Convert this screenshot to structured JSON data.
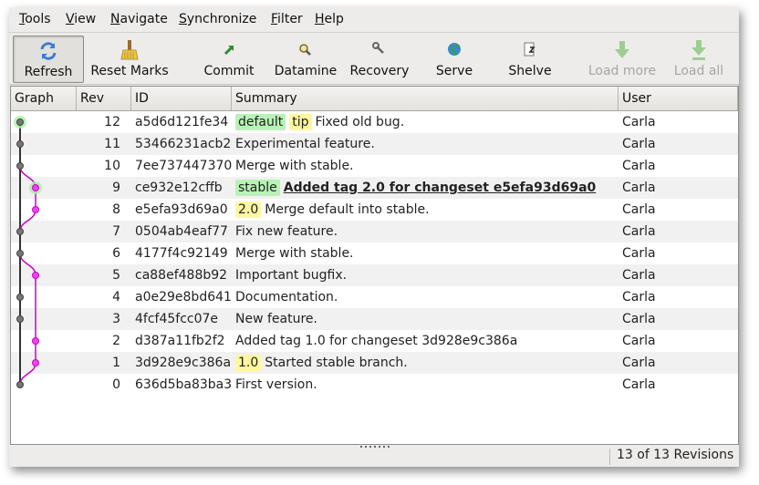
{
  "menu": [
    "Tools",
    "View",
    "Navigate",
    "Synchronize",
    "Filter",
    "Help"
  ],
  "menu_mnemonic": [
    "T",
    "V",
    "N",
    "S",
    "F",
    "H"
  ],
  "toolbar": {
    "refresh": "Refresh",
    "reset_marks": "Reset Marks",
    "commit": "Commit",
    "datamine": "Datamine",
    "recovery": "Recovery",
    "serve": "Serve",
    "shelve": "Shelve",
    "load_more": "Load more",
    "load_all": "Load all"
  },
  "columns": {
    "graph": "Graph",
    "rev": "Rev",
    "id": "ID",
    "summary": "Summary",
    "user": "User"
  },
  "rows": [
    {
      "rev": "12",
      "id": "a5d6d121fe34",
      "tags": [
        {
          "text": "default",
          "color": "green"
        },
        {
          "text": "tip",
          "color": "yellow"
        }
      ],
      "summary": "Fixed old bug.",
      "user": "Carla"
    },
    {
      "rev": "11",
      "id": "53466231acb2",
      "tags": [],
      "summary": "Experimental feature.",
      "user": "Carla"
    },
    {
      "rev": "10",
      "id": "7ee737447370",
      "tags": [],
      "summary": "Merge with stable.",
      "user": "Carla"
    },
    {
      "rev": "9",
      "id": "ce932e12cffb",
      "tags": [
        {
          "text": "stable",
          "color": "green"
        }
      ],
      "summary": "Added tag 2.0 for changeset e5efa93d69a0",
      "user": "Carla",
      "current": true
    },
    {
      "rev": "8",
      "id": "e5efa93d69a0",
      "tags": [
        {
          "text": "2.0",
          "color": "yellow"
        }
      ],
      "summary": "Merge default into stable.",
      "user": "Carla"
    },
    {
      "rev": "7",
      "id": "0504ab4eaf77",
      "tags": [],
      "summary": "Fix new feature.",
      "user": "Carla"
    },
    {
      "rev": "6",
      "id": "4177f4c92149",
      "tags": [],
      "summary": "Merge with stable.",
      "user": "Carla"
    },
    {
      "rev": "5",
      "id": "ca88ef488b92",
      "tags": [],
      "summary": "Important bugfix.",
      "user": "Carla"
    },
    {
      "rev": "4",
      "id": "a0e29e8bd641",
      "tags": [],
      "summary": "Documentation.",
      "user": "Carla"
    },
    {
      "rev": "3",
      "id": "4fcf45fcc07e",
      "tags": [],
      "summary": "New feature.",
      "user": "Carla"
    },
    {
      "rev": "2",
      "id": "d387a11fb2f2",
      "tags": [],
      "summary": "Added tag 1.0 for changeset 3d928e9c386a",
      "user": "Carla"
    },
    {
      "rev": "1",
      "id": "3d928e9c386a",
      "tags": [
        {
          "text": "1.0",
          "color": "yellow"
        }
      ],
      "summary": "Started stable branch.",
      "user": "Carla"
    },
    {
      "rev": "0",
      "id": "636d5ba83ba3",
      "tags": [],
      "summary": "First version.",
      "user": "Carla"
    }
  ],
  "status": "13 of 13 Revisions",
  "colors": {
    "branch_default": "#333333",
    "branch_stable": "#cc00cc",
    "tag_green": "#b8f2b6",
    "tag_yellow": "#fff7a0",
    "working_parent_halo": "#a6f0a6"
  }
}
